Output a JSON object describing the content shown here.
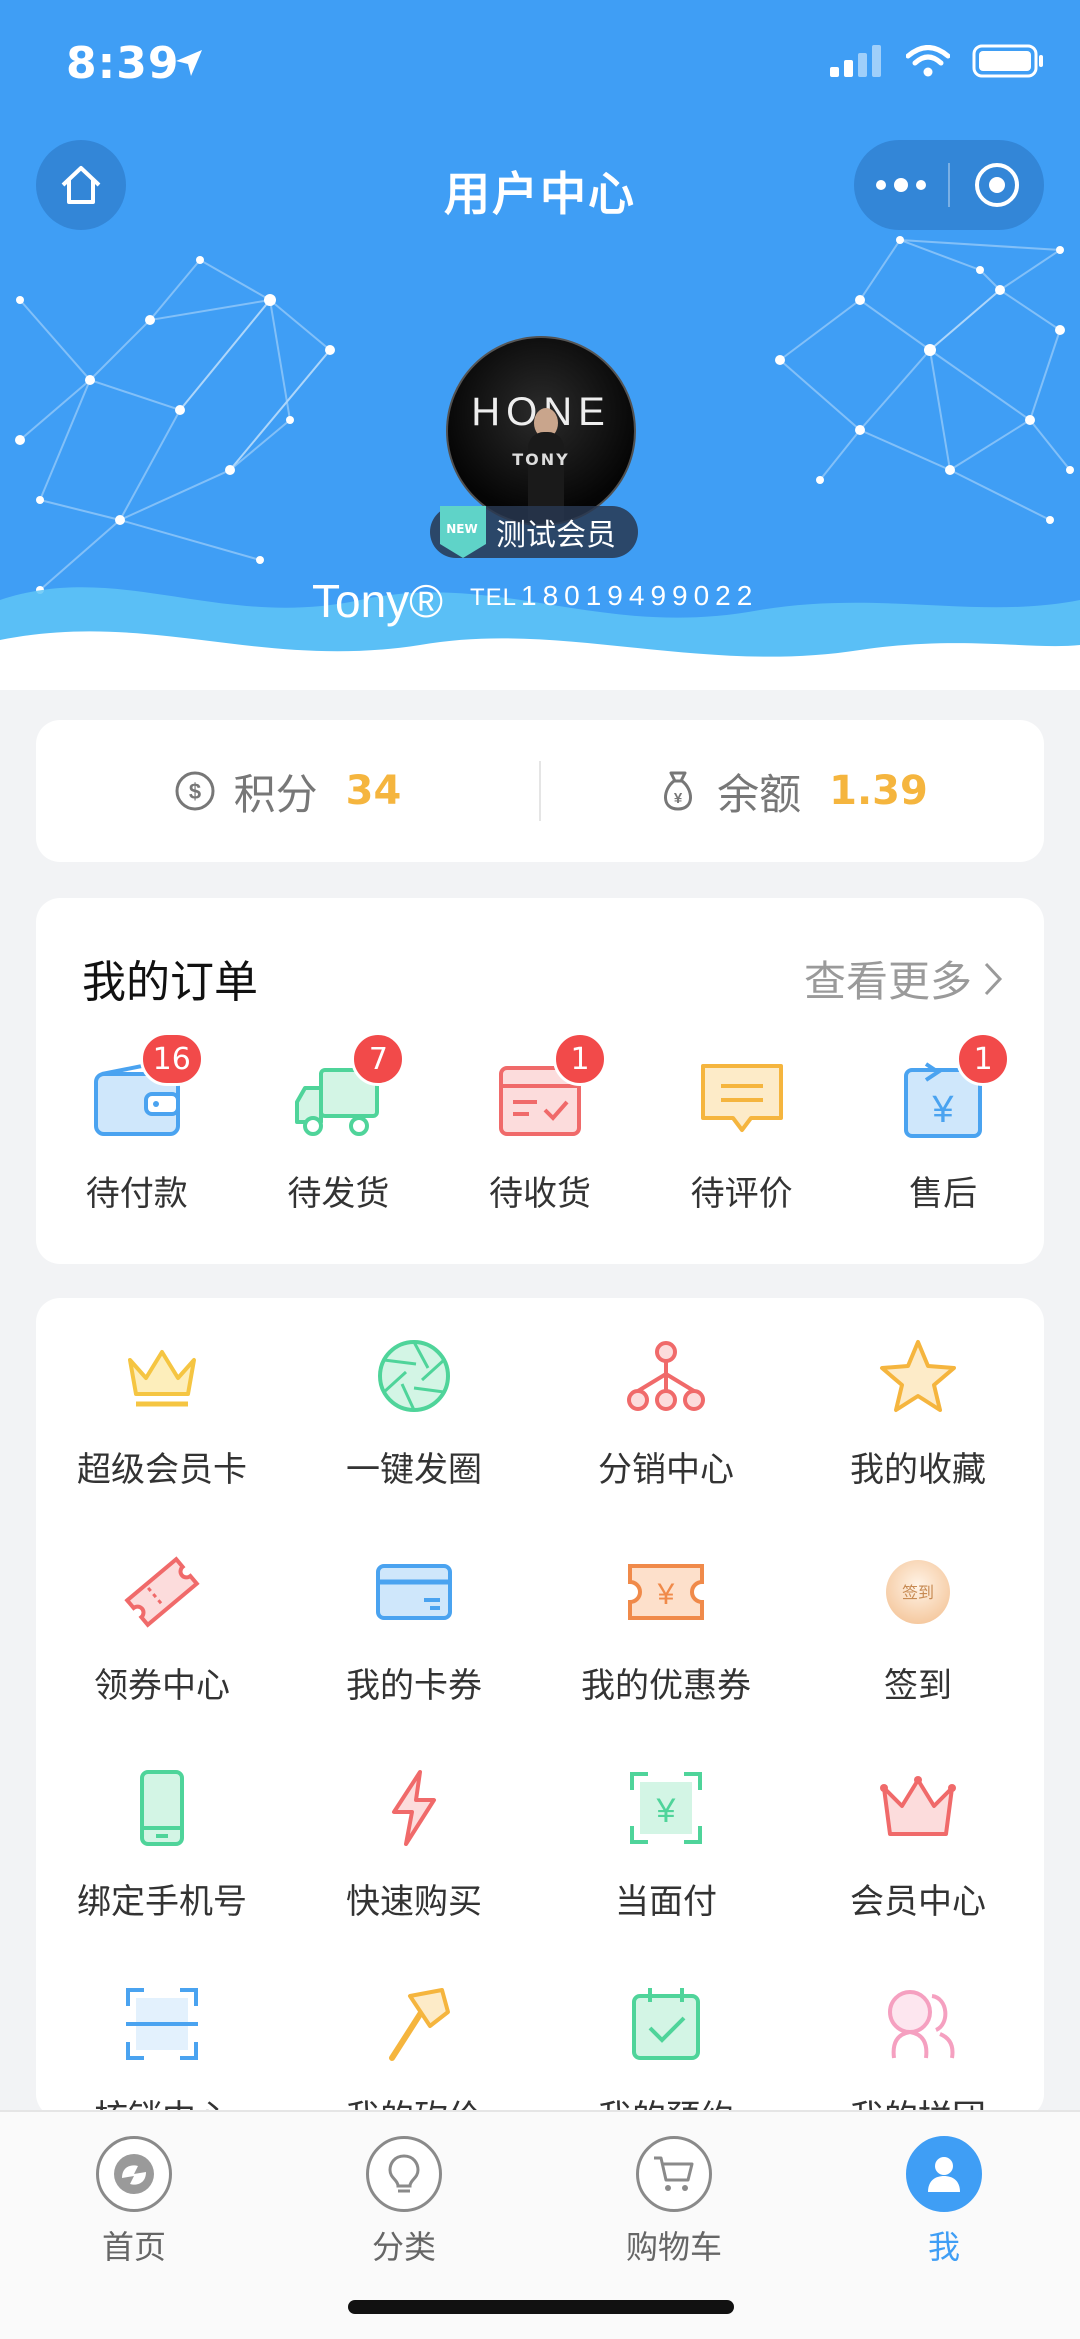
{
  "status_bar": {
    "time": "8:39"
  },
  "nav": {
    "title": "用户中心"
  },
  "profile": {
    "avatar_text": "HONE",
    "avatar_sub": "TONY",
    "badge_new": "NEW",
    "member_level": "测试会员",
    "username": "Tony®",
    "tel_prefix": "TEL",
    "phone": "18019499022"
  },
  "balance": {
    "points_label": "积分",
    "points_value": "34",
    "balance_label": "余额",
    "balance_value": "1.39"
  },
  "orders": {
    "title": "我的订单",
    "more_label": "查看更多",
    "items": [
      {
        "label": "待付款",
        "badge": "16",
        "icon": "wallet-icon",
        "color": "#4aa3f0"
      },
      {
        "label": "待发货",
        "badge": "7",
        "icon": "truck-icon",
        "color": "#4fd49a"
      },
      {
        "label": "待收货",
        "badge": "1",
        "icon": "package-icon",
        "color": "#f06a6a"
      },
      {
        "label": "待评价",
        "badge": "",
        "icon": "comment-icon",
        "color": "#f5b53e"
      },
      {
        "label": "售后",
        "badge": "1",
        "icon": "refund-icon",
        "color": "#4aa3f0"
      }
    ]
  },
  "services": [
    {
      "label": "超级会员卡",
      "icon": "crown-icon",
      "color": "#f5c542"
    },
    {
      "label": "一键发圈",
      "icon": "aperture-icon",
      "color": "#4fd49a"
    },
    {
      "label": "分销中心",
      "icon": "network-icon",
      "color": "#f06a6a"
    },
    {
      "label": "我的收藏",
      "icon": "star-icon",
      "color": "#f5b53e"
    },
    {
      "label": "领券中心",
      "icon": "ticket-icon",
      "color": "#f06a6a"
    },
    {
      "label": "我的卡券",
      "icon": "card-icon",
      "color": "#4aa3f0"
    },
    {
      "label": "我的优惠券",
      "icon": "coupon-icon",
      "color": "#f08a4a"
    },
    {
      "label": "签到",
      "icon": "checkin-icon",
      "color": "#f5b53e",
      "icon_text": "签到"
    },
    {
      "label": "绑定手机号",
      "icon": "phone-icon",
      "color": "#4fd49a"
    },
    {
      "label": "快速购买",
      "icon": "lightning-icon",
      "color": "#f06a6a"
    },
    {
      "label": "当面付",
      "icon": "scan-pay-icon",
      "color": "#4fd49a"
    },
    {
      "label": "会员中心",
      "icon": "crown-outline-icon",
      "color": "#f06a6a"
    },
    {
      "label": "核销中心",
      "icon": "scan-icon",
      "color": "#4aa3f0"
    },
    {
      "label": "我的砍价",
      "icon": "axe-icon",
      "color": "#f5b53e"
    },
    {
      "label": "我的预约",
      "icon": "calendar-check-icon",
      "color": "#4fd49a"
    },
    {
      "label": "我的拼团",
      "icon": "group-icon",
      "color": "#f5a0c0"
    }
  ],
  "tabbar": [
    {
      "label": "首页",
      "icon": "home-logo-icon",
      "active": false
    },
    {
      "label": "分类",
      "icon": "bulb-icon",
      "active": false
    },
    {
      "label": "购物车",
      "icon": "cart-icon",
      "active": false
    },
    {
      "label": "我",
      "icon": "user-icon",
      "active": true
    }
  ],
  "colors": {
    "primary": "#3f9ef5",
    "accent": "#f5b53e",
    "badge": "#f24a4a"
  }
}
